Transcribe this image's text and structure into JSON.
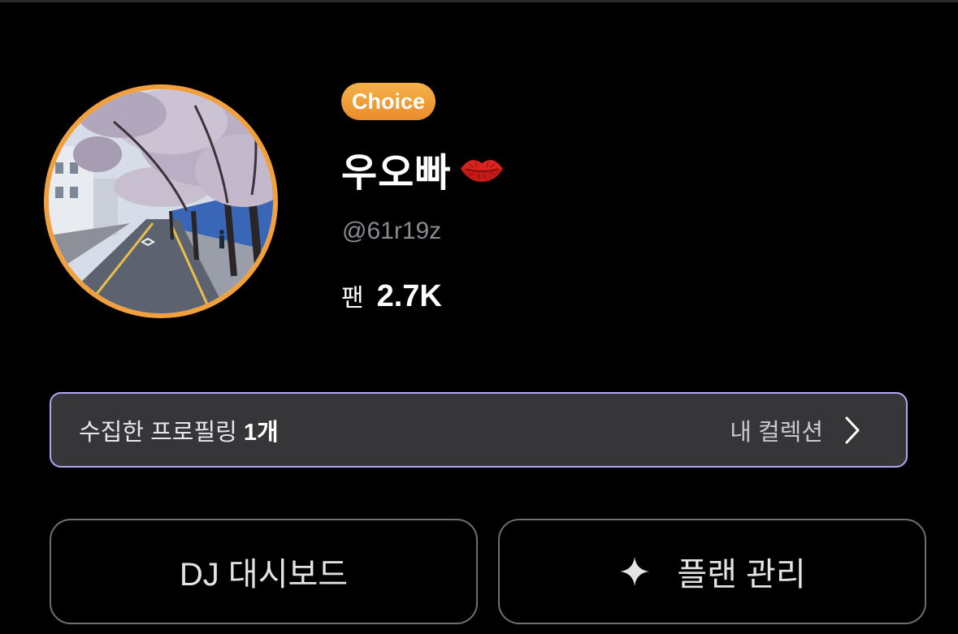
{
  "profile": {
    "badge": "Choice",
    "name": "우오빠",
    "handle": "@61r19z",
    "fans_label": "팬",
    "fans_value": "2.7K",
    "name_emoji_icon": "kiss-lips-icon",
    "avatar_description_icon": "avatar-photo"
  },
  "collection": {
    "prefix": "수집한 프로필링 ",
    "count": "1개",
    "link_label": "내 컬렉션"
  },
  "actions": {
    "dj_dashboard": "DJ 대시보드",
    "plan_manage": "플랜 관리"
  },
  "colors": {
    "badge": "#ea8c2a",
    "avatar_ring": "#f2a03d",
    "collection_border": "#b3a6ee",
    "background": "#000000"
  }
}
